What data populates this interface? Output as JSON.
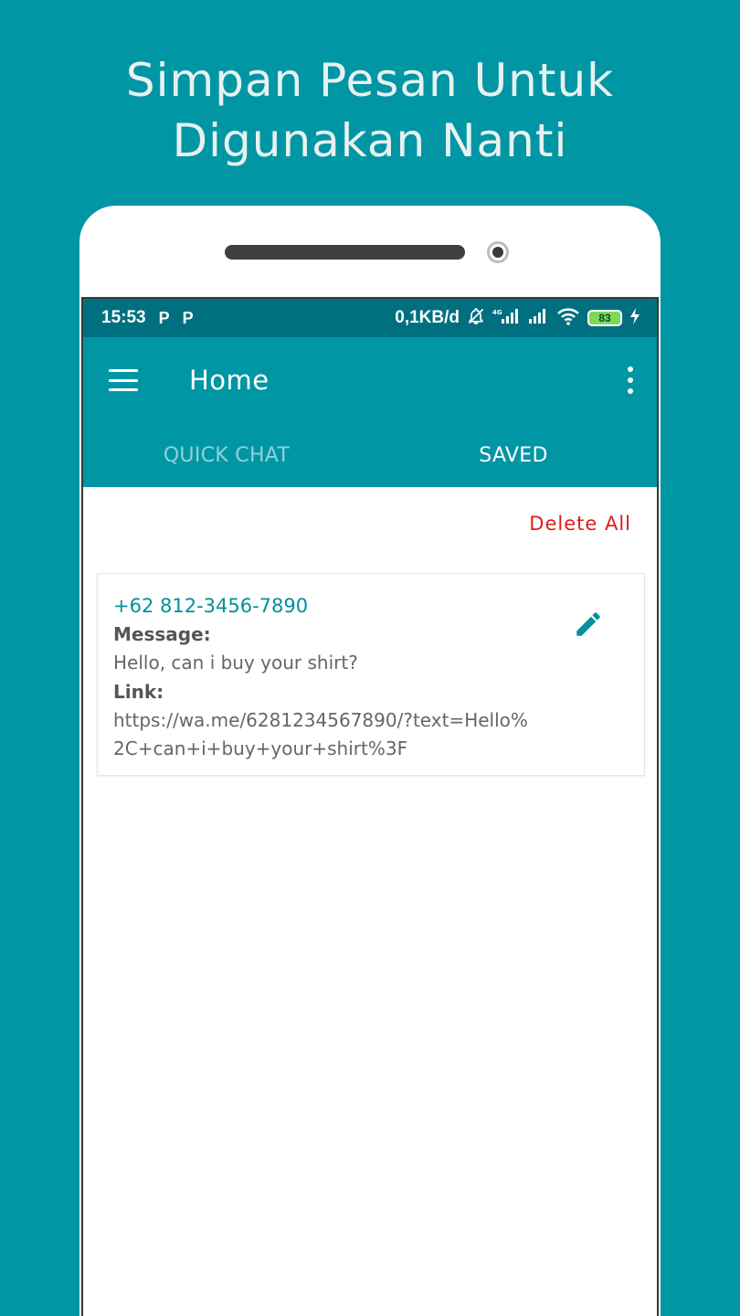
{
  "headline": {
    "line1": "Simpan Pesan Untuk",
    "line2": "Digunakan Nanti"
  },
  "statusbar": {
    "time": "15:53",
    "app_icons": [
      "P",
      "P"
    ],
    "speed": "0,1KB/d",
    "network": "4G",
    "battery": "83"
  },
  "appbar": {
    "title": "Home"
  },
  "tabs": [
    {
      "label": "QUICK CHAT",
      "active": false
    },
    {
      "label": "SAVED",
      "active": true
    }
  ],
  "actions": {
    "delete_all": "Delete All"
  },
  "saved_items": [
    {
      "phone": "+62 812-3456-7890",
      "message_label": "Message:",
      "message": "Hello, can i buy your shirt?",
      "link_label": "Link:",
      "link": "https://wa.me/6281234567890/?text=Hello%2C+can+i+buy+your+shirt%3F"
    }
  ],
  "colors": {
    "background": "#0096a4",
    "statusbar": "#007080",
    "accent": "#00909e",
    "danger": "#e01b1b"
  }
}
